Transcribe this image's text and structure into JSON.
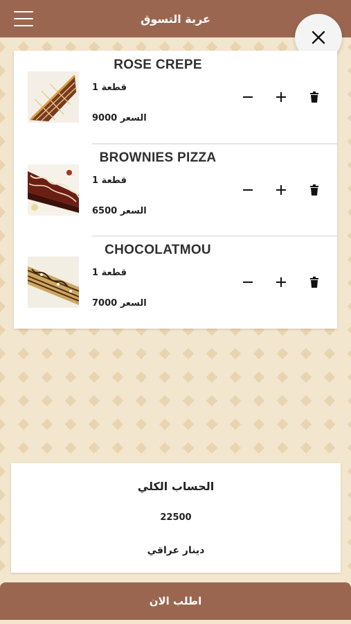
{
  "header": {
    "title": "عربة التسوق",
    "menu_icon": "hamburger-menu-icon",
    "close_icon": "close-icon"
  },
  "colors": {
    "primary": "#9a6650",
    "background": "#f3e6cf",
    "card": "#ffffff"
  },
  "items": [
    {
      "name": "ROSE CREPE",
      "quantity": "قطعة 1",
      "price": "السعر 9000"
    },
    {
      "name": "BROWNIES PIZZA",
      "quantity": "قطعة 1",
      "price": "السعر 6500"
    },
    {
      "name": "CHOCOLATMOU",
      "quantity": "قطعة 1",
      "price": "السعر 7000"
    }
  ],
  "item_controls": {
    "decrease_icon": "minus-icon",
    "increase_icon": "plus-icon",
    "delete_icon": "trash-icon"
  },
  "total": {
    "title": "الحساب الكلي",
    "amount": "22500",
    "currency": "دينار عراقي"
  },
  "order_button": {
    "label": "اطلب الان"
  }
}
